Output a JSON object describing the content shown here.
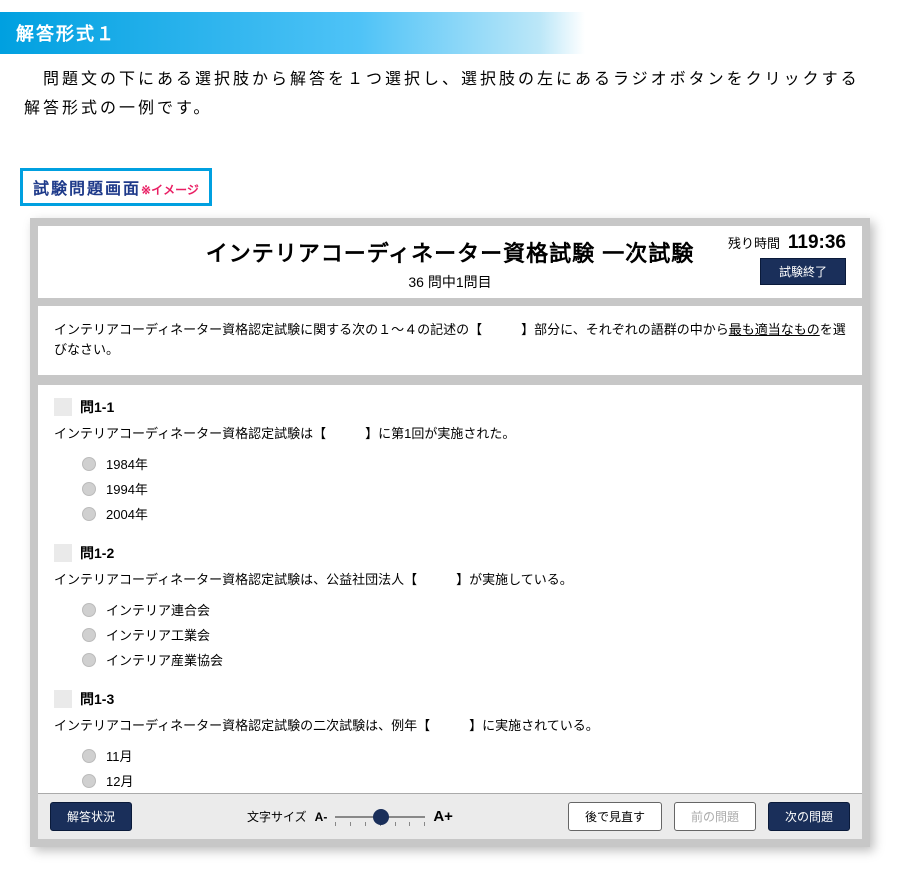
{
  "section_header": "解答形式１",
  "description": "　問題文の下にある選択肢から解答を１つ選択し、選択肢の左にあるラジオボタンをクリックする解答形式の一例です。",
  "image_label": {
    "main": "試験問題画面",
    "sub": "※イメージ"
  },
  "exam": {
    "title": "インテリアコーディネーター資格試験 一次試験",
    "counter": "36 問中1問目",
    "timer_label": "残り時間",
    "timer_value": "119:36",
    "end_button": "試験終了"
  },
  "instruction": {
    "prefix": "インテリアコーディネーター資格認定試験に関する次の１～４の記述の【　　　】部分に、それぞれの語群の中から",
    "underlined": "最も適当なもの",
    "suffix": "を選びなさい。"
  },
  "sub_questions": [
    {
      "label": "問1-1",
      "text": "インテリアコーディネーター資格認定試験は【　　　】に第1回が実施された。",
      "options": [
        "1984年",
        "1994年",
        "2004年"
      ]
    },
    {
      "label": "問1-2",
      "text": "インテリアコーディネーター資格認定試験は、公益社団法人【　　　】が実施している。",
      "options": [
        "インテリア連合会",
        "インテリア工業会",
        "インテリア産業協会"
      ]
    },
    {
      "label": "問1-3",
      "text": "インテリアコーディネーター資格認定試験の二次試験は、例年【　　　】に実施されている。",
      "options": [
        "11月",
        "12月"
      ]
    }
  ],
  "footer": {
    "status_button": "解答状況",
    "fontsize_label": "文字サイズ",
    "fontsize_minus": "A-",
    "fontsize_plus": "A+",
    "review_button": "後で見直す",
    "prev_button": "前の問題",
    "next_button": "次の問題"
  }
}
